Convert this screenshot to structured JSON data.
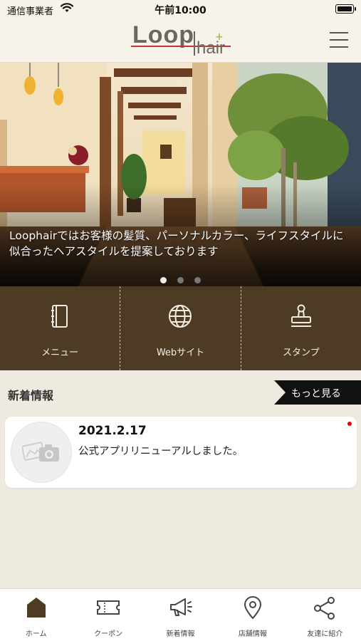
{
  "status_bar": {
    "carrier": "通信事業者",
    "time": "午前10:00"
  },
  "header": {
    "logo_main": "Loop",
    "logo_sub": "hair",
    "menu_icon": "hamburger-icon"
  },
  "hero": {
    "caption": "Loophairではお客様の髪質、パーソナルカラー、ライフスタイルに似合ったヘアスタイルを提案しております",
    "slide_count": 3,
    "active_slide": 1
  },
  "quick_menu": [
    {
      "label": "メニュー",
      "icon": "notebook-icon"
    },
    {
      "label": "Webサイト",
      "icon": "globe-icon"
    },
    {
      "label": "スタンプ",
      "icon": "stamp-icon"
    }
  ],
  "news": {
    "heading": "新着情報",
    "more_label": "もっと見る",
    "items": [
      {
        "date": "2021.2.17",
        "text": "公式アプリリニューアルしました。",
        "unread": true
      }
    ]
  },
  "tab_bar": [
    {
      "label": "ホーム",
      "icon": "home-icon",
      "active": true
    },
    {
      "label": "クーポン",
      "icon": "ticket-icon",
      "active": false
    },
    {
      "label": "新着情報",
      "icon": "megaphone-icon",
      "active": false
    },
    {
      "label": "店舗情報",
      "icon": "map-pin-icon",
      "active": false
    },
    {
      "label": "友達に紹介",
      "icon": "share-icon",
      "active": false
    }
  ],
  "colors": {
    "brand_brown": "#4d3b24",
    "background": "#efeae0",
    "logo_red": "#c2333a",
    "logo_green": "#a5c242"
  }
}
